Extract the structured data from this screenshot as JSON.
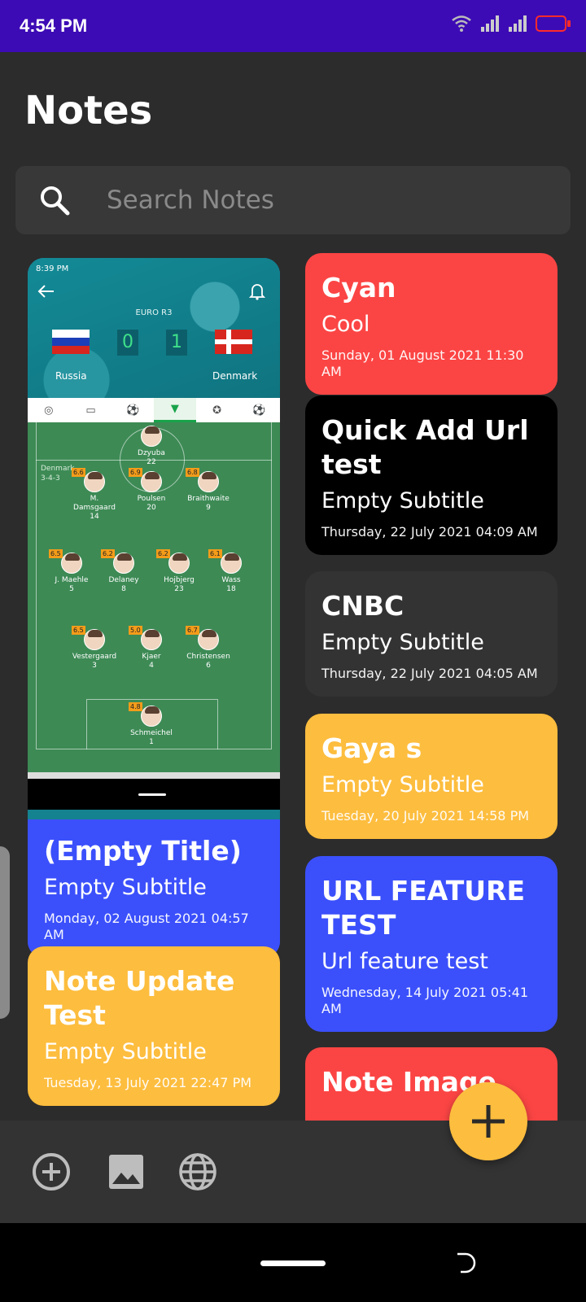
{
  "status_bar": {
    "time": "4:54 PM"
  },
  "header": {
    "title": "Notes"
  },
  "search": {
    "placeholder": "Search Notes"
  },
  "image_note": {
    "screenshot": {
      "status_time": "8:39 PM",
      "competition": "EURO R3",
      "home_team": "Russia",
      "away_team": "Denmark",
      "home_score": "0",
      "away_score": "1",
      "formation_team": "Denmark",
      "formation": "3-4-3",
      "players": [
        {
          "name": "Dzyuba",
          "number": "22",
          "rating": ""
        },
        {
          "name": "M. Damsgaard",
          "number": "14",
          "rating": "6.6"
        },
        {
          "name": "Poulsen",
          "number": "20",
          "rating": "6.9"
        },
        {
          "name": "Braithwaite",
          "number": "9",
          "rating": "6.8"
        },
        {
          "name": "J. Maehle",
          "number": "5",
          "rating": "6.5"
        },
        {
          "name": "Delaney",
          "number": "8",
          "rating": "6.2"
        },
        {
          "name": "Hojbjerg",
          "number": "23",
          "rating": "6.2"
        },
        {
          "name": "Wass",
          "number": "18",
          "rating": "6.1"
        },
        {
          "name": "Vestergaard",
          "number": "3",
          "rating": "6.5"
        },
        {
          "name": "Kjaer",
          "number": "4",
          "rating": "5.0"
        },
        {
          "name": "Christensen",
          "number": "6",
          "rating": "6.7"
        },
        {
          "name": "Schmeichel",
          "number": "1",
          "rating": "4.8"
        }
      ]
    },
    "title": "(Empty Title)",
    "subtitle": "Empty Subtitle",
    "date": "Monday, 02 August 2021 04:57 AM"
  },
  "notes_left": [
    {
      "title": "Note Update Test",
      "subtitle": "Empty Subtitle",
      "date": "Tuesday, 13 July 2021 22:47 PM",
      "color": "#fdbd3e"
    }
  ],
  "notes_right": [
    {
      "title": "Cyan",
      "subtitle": "Cool",
      "date": "Sunday, 01 August 2021 11:30 AM",
      "color": "#fb4544"
    },
    {
      "title": "Quick Add Url test",
      "subtitle": "Empty Subtitle",
      "date": "Thursday, 22 July 2021 04:09 AM",
      "color": "#000000"
    },
    {
      "title": "CNBC",
      "subtitle": "Empty Subtitle",
      "date": "Thursday, 22 July 2021 04:05 AM",
      "color": "#333333"
    },
    {
      "title": "Gaya s",
      "subtitle": "Empty Subtitle",
      "date": "Tuesday, 20 July 2021 14:58 PM",
      "color": "#fdbd3e"
    },
    {
      "title": "URL FEATURE TEST",
      "subtitle": "Url feature test",
      "date": "Wednesday, 14 July 2021 05:41 AM",
      "color": "#3b50fb"
    },
    {
      "title": "Note Image",
      "subtitle": "",
      "date": "",
      "color": "#fb4544"
    }
  ],
  "bottom_bar": {
    "icons": [
      "add-circle-icon",
      "image-icon",
      "globe-icon"
    ],
    "fab_icon": "plus-icon"
  },
  "colors": {
    "status_bar": "#3d0bb5",
    "background": "#2c2c2c",
    "accent": "#fdbd3e"
  }
}
